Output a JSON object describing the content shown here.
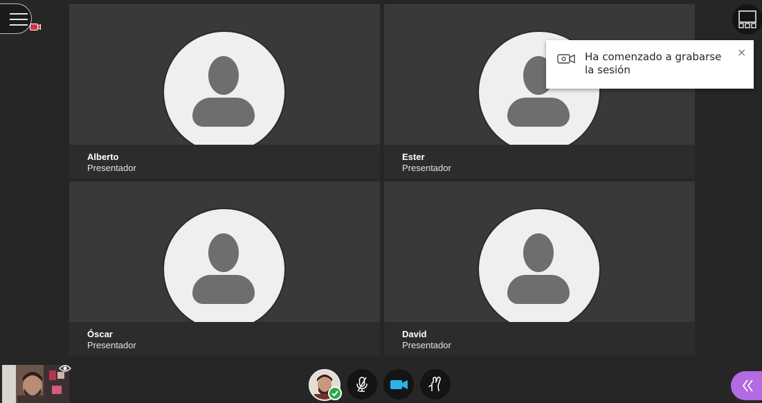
{
  "participants": [
    {
      "name": "Alberto",
      "role": "Presentador"
    },
    {
      "name": "Ester",
      "role": "Presentador"
    },
    {
      "name": "Óscar",
      "role": "Presentador"
    },
    {
      "name": "David",
      "role": "Presentador"
    }
  ],
  "toast": {
    "message": "Ha comenzado a grabarse la sesión",
    "close": "×"
  },
  "icons": {
    "menu": "hamburger-menu-icon",
    "recording": "recording-camera-icon",
    "layout": "layout-grid-icon",
    "eye": "eye-icon",
    "mic": "microphone-muted-icon",
    "camera": "video-camera-icon",
    "hand": "raise-hand-icon",
    "collab": "double-chevron-left-icon"
  },
  "colors": {
    "tile": "#393939",
    "background": "#262626",
    "camera_active": "#29b3e8",
    "collab_panel": "#b36ae3",
    "status_ok": "#2fa84f",
    "recording": "#d0343a"
  }
}
